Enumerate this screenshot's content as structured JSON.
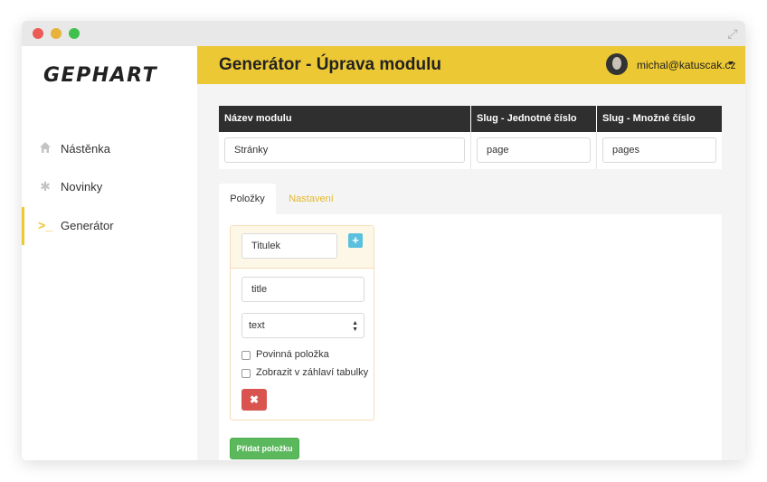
{
  "app": {
    "logo": "GEPHART"
  },
  "sidebar": {
    "items": [
      {
        "label": "Nástěnka",
        "icon": "home-icon"
      },
      {
        "label": "Novinky",
        "icon": "asterisk-icon"
      },
      {
        "label": "Generátor",
        "icon": "terminal-icon",
        "active": true
      }
    ]
  },
  "header": {
    "title": "Generátor - Úprava modulu",
    "user": "michal@katuscak.cz"
  },
  "module_table": {
    "headers": [
      "Název modulu",
      "Slug - Jednotné číslo",
      "Slug - Množné číslo"
    ],
    "values": [
      "Stránky",
      "page",
      "pages"
    ]
  },
  "tabs": [
    {
      "label": "Položky",
      "active": true
    },
    {
      "label": "Nastavení",
      "active": false
    }
  ],
  "item": {
    "title": "Titulek",
    "slug": "title",
    "type": "text",
    "required_label": "Povinná položka",
    "show_in_header_label": "Zobrazit v záhlaví tabulky"
  },
  "add_item_label": "Přidat položku",
  "colors": {
    "accent": "#ecc834",
    "dark": "#2f2f2f",
    "danger": "#d9534f",
    "success": "#5cb85c",
    "info": "#5bc0de"
  }
}
